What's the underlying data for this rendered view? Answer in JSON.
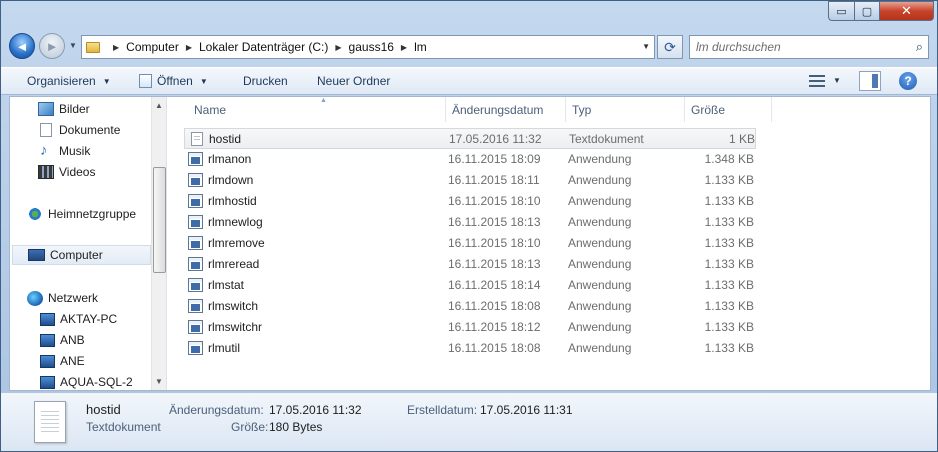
{
  "window": {
    "controls": {
      "minimize": "▭",
      "maximize": "▢",
      "close": "✕"
    }
  },
  "nav": {
    "back_glyph": "◄",
    "forward_glyph": "►",
    "dropdown_glyph": "▼",
    "breadcrumb": [
      "Computer",
      "Lokaler Datenträger (C:)",
      "gauss16",
      "lm"
    ],
    "refresh_glyph": "⟳",
    "search_placeholder": "lm durchsuchen",
    "search_glyph": "⌕"
  },
  "toolbar": {
    "organize": "Organisieren",
    "open": "Öffnen",
    "print": "Drucken",
    "new_folder": "Neuer Ordner",
    "help": "?"
  },
  "sidebar": {
    "items": [
      {
        "label": "Bilder",
        "icon": "pictures-icon"
      },
      {
        "label": "Dokumente",
        "icon": "documents-icon"
      },
      {
        "label": "Musik",
        "icon": "music-icon"
      },
      {
        "label": "Videos",
        "icon": "videos-icon"
      },
      {
        "label": "Heimnetzgruppe",
        "icon": "homegroup-icon"
      },
      {
        "label": "Computer",
        "icon": "computer-icon",
        "selected": true
      },
      {
        "label": "Netzwerk",
        "icon": "network-icon"
      },
      {
        "label": "AKTAY-PC",
        "icon": "pc-icon"
      },
      {
        "label": "ANB",
        "icon": "pc-icon"
      },
      {
        "label": "ANE",
        "icon": "pc-icon"
      },
      {
        "label": "AQUA-SQL-2",
        "icon": "pc-icon"
      }
    ]
  },
  "columns": {
    "name": "Name",
    "date": "Änderungsdatum",
    "type": "Typ",
    "size": "Größe"
  },
  "files": [
    {
      "name": "hostid",
      "date": "17.05.2016 11:32",
      "type": "Textdokument",
      "size": "1 KB",
      "icon": "text-file-icon",
      "selected": true
    },
    {
      "name": "rlmanon",
      "date": "16.11.2015 18:09",
      "type": "Anwendung",
      "size": "1.348 KB",
      "icon": "application-icon"
    },
    {
      "name": "rlmdown",
      "date": "16.11.2015 18:11",
      "type": "Anwendung",
      "size": "1.133 KB",
      "icon": "application-icon"
    },
    {
      "name": "rlmhostid",
      "date": "16.11.2015 18:10",
      "type": "Anwendung",
      "size": "1.133 KB",
      "icon": "application-icon"
    },
    {
      "name": "rlmnewlog",
      "date": "16.11.2015 18:13",
      "type": "Anwendung",
      "size": "1.133 KB",
      "icon": "application-icon"
    },
    {
      "name": "rlmremove",
      "date": "16.11.2015 18:10",
      "type": "Anwendung",
      "size": "1.133 KB",
      "icon": "application-icon"
    },
    {
      "name": "rlmreread",
      "date": "16.11.2015 18:13",
      "type": "Anwendung",
      "size": "1.133 KB",
      "icon": "application-icon"
    },
    {
      "name": "rlmstat",
      "date": "16.11.2015 18:14",
      "type": "Anwendung",
      "size": "1.133 KB",
      "icon": "application-icon"
    },
    {
      "name": "rlmswitch",
      "date": "16.11.2015 18:08",
      "type": "Anwendung",
      "size": "1.133 KB",
      "icon": "application-icon"
    },
    {
      "name": "rlmswitchr",
      "date": "16.11.2015 18:12",
      "type": "Anwendung",
      "size": "1.133 KB",
      "icon": "application-icon"
    },
    {
      "name": "rlmutil",
      "date": "16.11.2015 18:08",
      "type": "Anwendung",
      "size": "1.133 KB",
      "icon": "application-icon"
    }
  ],
  "details": {
    "name": "hostid",
    "kind": "Textdokument",
    "modified_label": "Änderungsdatum:",
    "modified_value": "17.05.2016 11:32",
    "created_label": "Erstelldatum:",
    "created_value": "17.05.2016 11:31",
    "size_label": "Größe:",
    "size_value": "180 Bytes"
  }
}
